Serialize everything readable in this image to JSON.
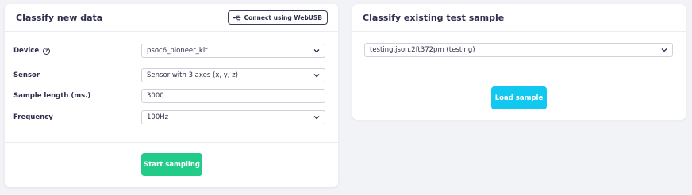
{
  "left_panel": {
    "title": "Classify new data",
    "webusb_label": "Connect using WebUSB",
    "device": {
      "label": "Device",
      "value": "psoc6_pioneer_kit"
    },
    "sensor": {
      "label": "Sensor",
      "value": "Sensor with 3 axes (x, y, z)"
    },
    "sample_length": {
      "label": "Sample length (ms.)",
      "value": "3000"
    },
    "frequency": {
      "label": "Frequency",
      "value": "100Hz"
    },
    "start_label": "Start sampling"
  },
  "right_panel": {
    "title": "Classify existing test sample",
    "sample_select": {
      "value": "testing.json.2ft372pm (testing)"
    },
    "load_label": "Load sample"
  },
  "icons": {
    "usb": "usb-icon",
    "help": "help-icon",
    "chevron": "chevron-down-icon"
  },
  "colors": {
    "start_button": "#22cc88",
    "load_button": "#11c8f0",
    "text": "#2e2e4d"
  }
}
